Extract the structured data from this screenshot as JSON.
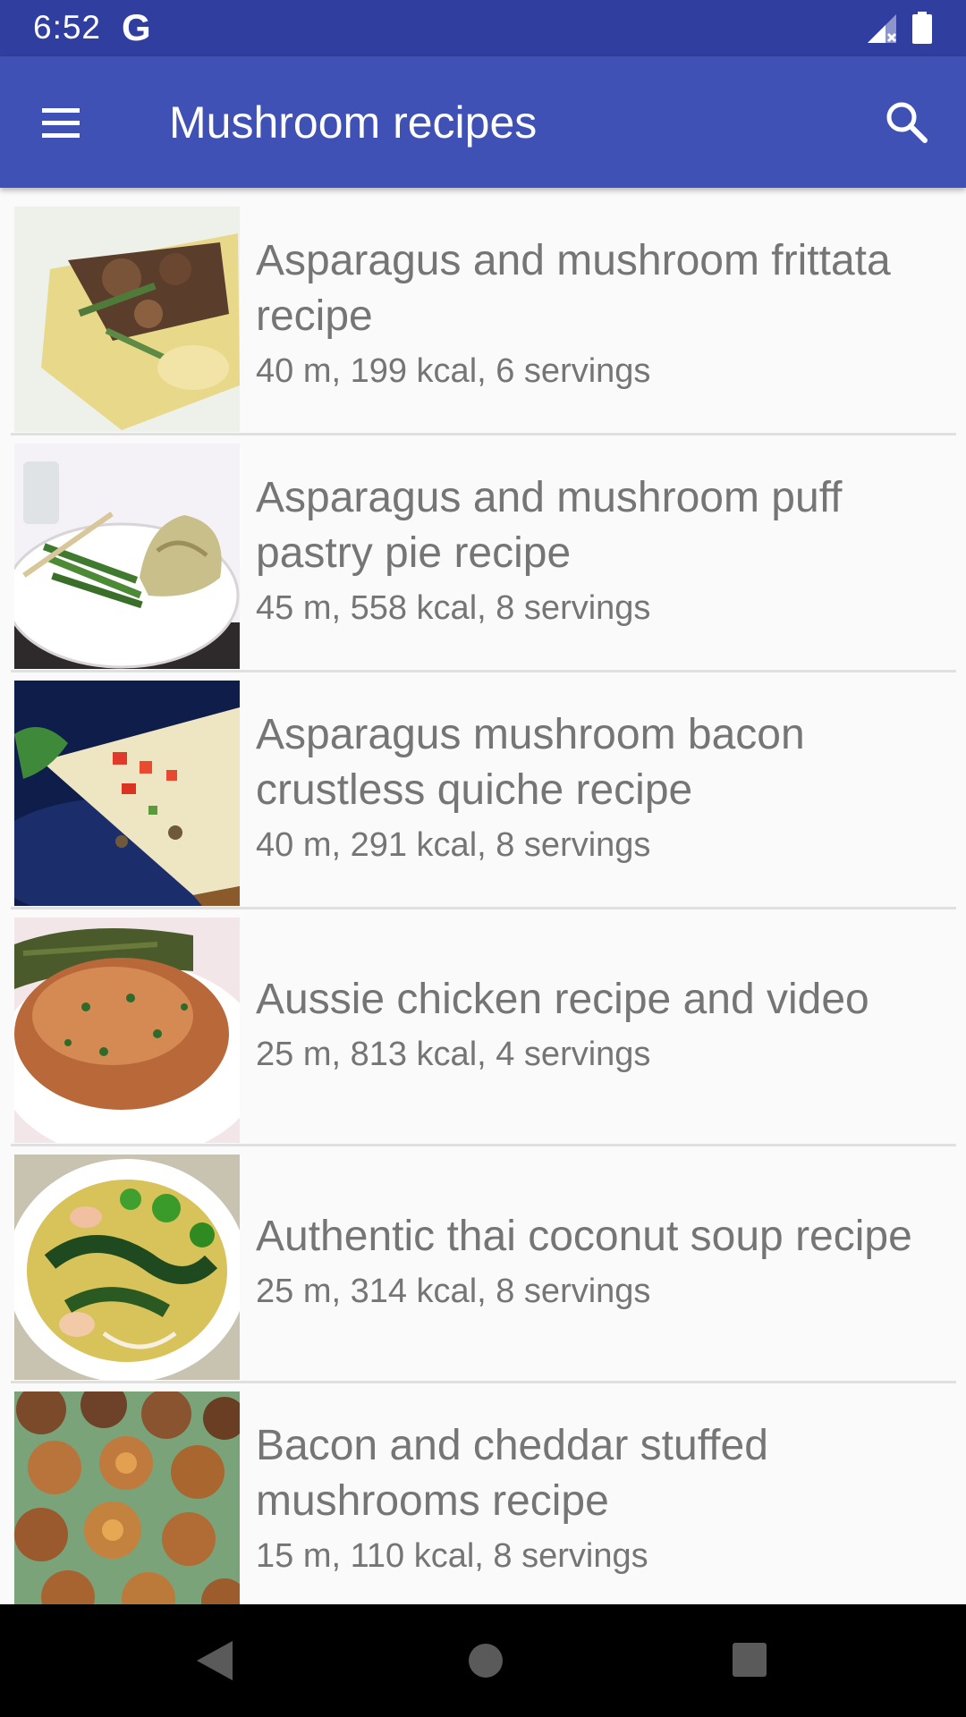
{
  "status_bar": {
    "time": "6:52",
    "notification_icon": "google-g-icon",
    "signal_icon": "signal-no-data-icon",
    "battery_icon": "battery-full-icon"
  },
  "app_bar": {
    "title": "Mushroom recipes",
    "menu_icon": "hamburger-menu-icon",
    "search_icon": "search-icon",
    "color": "#3f51b5",
    "status_color": "#303f9f"
  },
  "recipes": [
    {
      "title": "Asparagus and mushroom frittata recipe",
      "meta": "40 m, 199 kcal, 6 servings"
    },
    {
      "title": "Asparagus and mushroom puff pastry pie recipe",
      "meta": "45 m, 558 kcal, 8 servings"
    },
    {
      "title": "Asparagus mushroom bacon crustless quiche recipe",
      "meta": "40 m, 291 kcal, 8 servings"
    },
    {
      "title": "Aussie chicken recipe and video",
      "meta": "25 m, 813 kcal, 4 servings"
    },
    {
      "title": "Authentic thai coconut soup recipe",
      "meta": "25 m, 314 kcal, 8 servings"
    },
    {
      "title": "Bacon and cheddar stuffed mushrooms recipe",
      "meta": "15 m, 110 kcal, 8 servings"
    }
  ],
  "nav_bar": {
    "back_icon": "back-triangle-icon",
    "home_icon": "home-circle-icon",
    "recents_icon": "recents-square-icon"
  }
}
